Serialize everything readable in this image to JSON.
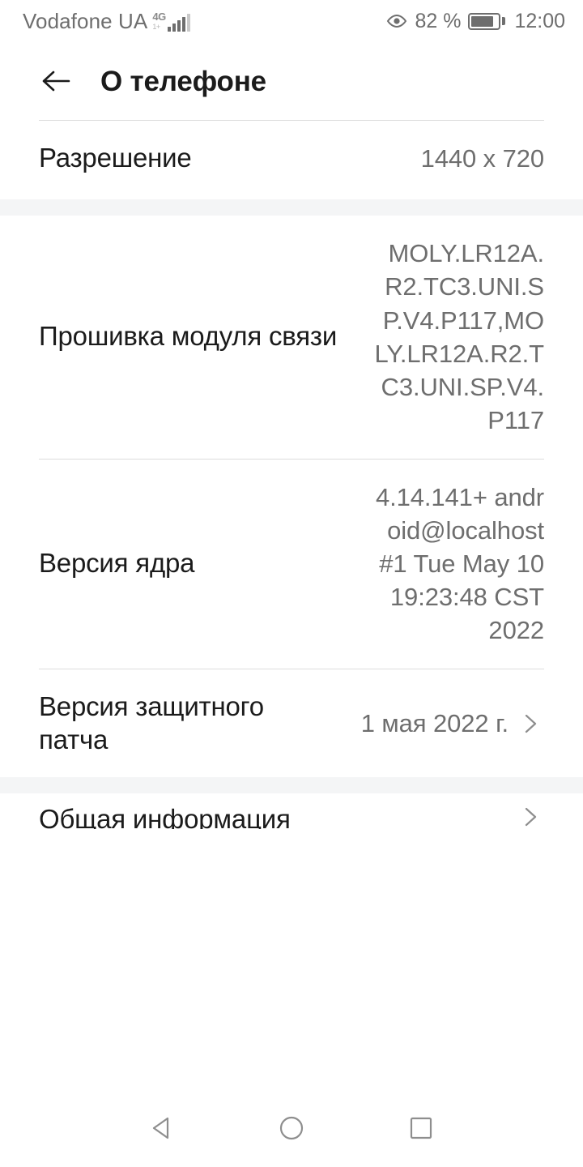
{
  "status_bar": {
    "carrier": "Vodafone UA",
    "network_type": "4G",
    "network_sub": "1+",
    "signal_icon": "signal-bars-icon",
    "eye_icon": "eye-icon",
    "battery_percent": "82 %",
    "battery_icon": "battery-icon",
    "time": "12:00"
  },
  "app_bar": {
    "back_icon": "back-arrow-icon",
    "title": "О телефоне"
  },
  "rows": [
    {
      "label": "Разрешение",
      "value": "1440 x 720"
    },
    {
      "label": "Прошивка модуля связи",
      "value": "MOLY.LR12A.R2.TC3.UNI.SP.V4.P117,MOLY.LR12A.R2.TC3.UNI.SP.V4.P117"
    },
    {
      "label": "Версия ядра",
      "value": "4.14.141+ android@localhost #1 Tue May 10 19:23:48 CST 2022"
    },
    {
      "label": "Версия защитного патча",
      "value": "1 мая 2022 г.",
      "chevron": "chevron-right-icon"
    },
    {
      "label": "Общая информация",
      "chevron": "chevron-right-icon"
    }
  ],
  "nav_bar": {
    "back": "nav-back-icon",
    "home": "nav-home-icon",
    "recents": "nav-recents-icon"
  },
  "colors": {
    "text_primary": "#1b1b1b",
    "text_secondary": "#6e6e6e",
    "divider": "#dcdcdc",
    "band": "#f4f5f6",
    "background": "#ffffff"
  }
}
